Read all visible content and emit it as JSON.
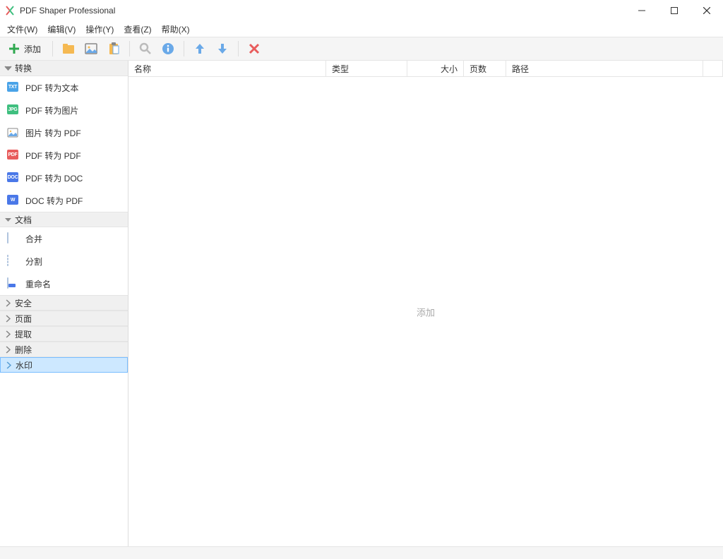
{
  "app": {
    "title": "PDF Shaper Professional"
  },
  "menu": {
    "file": "文件(W)",
    "edit": "编辑(V)",
    "action": "操作(Y)",
    "view": "查看(Z)",
    "help": "帮助(X)"
  },
  "toolbar": {
    "add": "添加"
  },
  "sidebar": {
    "convert_label": "转换",
    "convert": [
      {
        "label": "PDF 转为文本",
        "badge": "TXT",
        "cls": "txt"
      },
      {
        "label": "PDF 转为图片",
        "badge": "JPG",
        "cls": "jpg"
      },
      {
        "label": "图片 转为 PDF",
        "badge": "",
        "cls": "imgicon"
      },
      {
        "label": "PDF 转为 PDF",
        "badge": "PDF",
        "cls": "pdf"
      },
      {
        "label": "PDF 转为 DOC",
        "badge": "DOC",
        "cls": "doc"
      },
      {
        "label": "DOC 转为 PDF",
        "badge": "W",
        "cls": "docw"
      }
    ],
    "document_label": "文档",
    "document": [
      {
        "label": "合并",
        "icon": "page"
      },
      {
        "label": "分割",
        "icon": "page-dashed"
      },
      {
        "label": "重命名",
        "icon": "rename"
      }
    ],
    "collapsed": [
      {
        "label": "安全"
      },
      {
        "label": "页面"
      },
      {
        "label": "提取"
      },
      {
        "label": "删除"
      },
      {
        "label": "水印",
        "selected": true
      }
    ]
  },
  "list": {
    "columns": {
      "name": "名称",
      "type": "类型",
      "size": "大小",
      "pages": "页数",
      "path": "路径"
    },
    "empty": "添加"
  }
}
